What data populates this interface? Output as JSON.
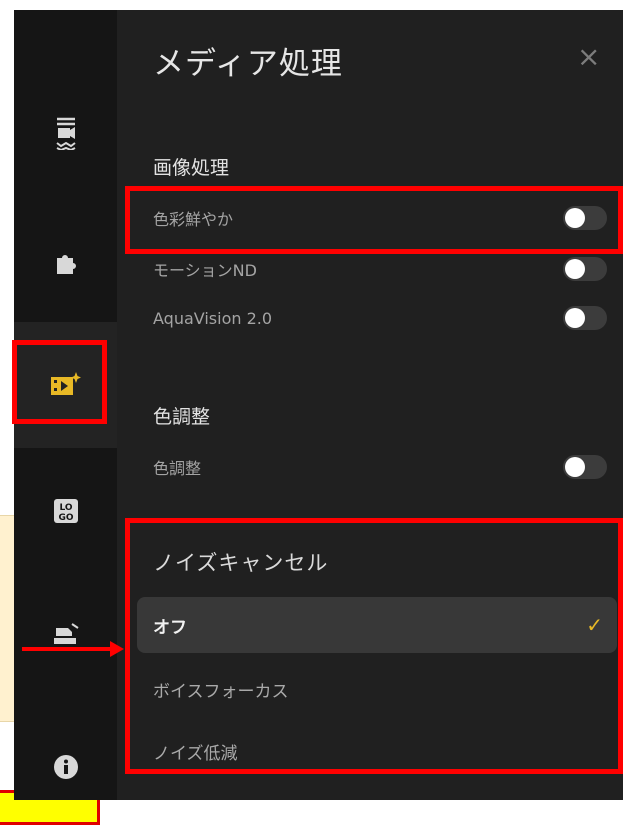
{
  "panel": {
    "title": "メディア処理",
    "close_icon": "×"
  },
  "sidebar": {
    "items": [
      {
        "icon": "video-stabilize-icon"
      },
      {
        "icon": "puzzle-icon"
      },
      {
        "icon": "media-processing-icon",
        "active": true
      },
      {
        "icon": "logo-icon"
      },
      {
        "icon": "layers-icon"
      },
      {
        "icon": "info-icon"
      }
    ]
  },
  "image_processing": {
    "heading": "画像処理",
    "items": [
      {
        "label": "色彩鮮やか",
        "enabled": false
      },
      {
        "label": "モーションND",
        "enabled": false
      },
      {
        "label": "AquaVision 2.0",
        "enabled": false
      }
    ]
  },
  "color_adjust": {
    "heading": "色調整",
    "items": [
      {
        "label": "色調整",
        "enabled": false
      }
    ]
  },
  "noise_cancel": {
    "heading": "ノイズキャンセル",
    "options": [
      {
        "label": "オフ",
        "selected": true
      },
      {
        "label": "ボイスフォーカス",
        "selected": false
      },
      {
        "label": "ノイズ低減",
        "selected": false
      }
    ],
    "check_icon": "✓"
  },
  "colors": {
    "highlight": "#ff0000",
    "accent": "#e8b926",
    "note": "#ffff00"
  }
}
